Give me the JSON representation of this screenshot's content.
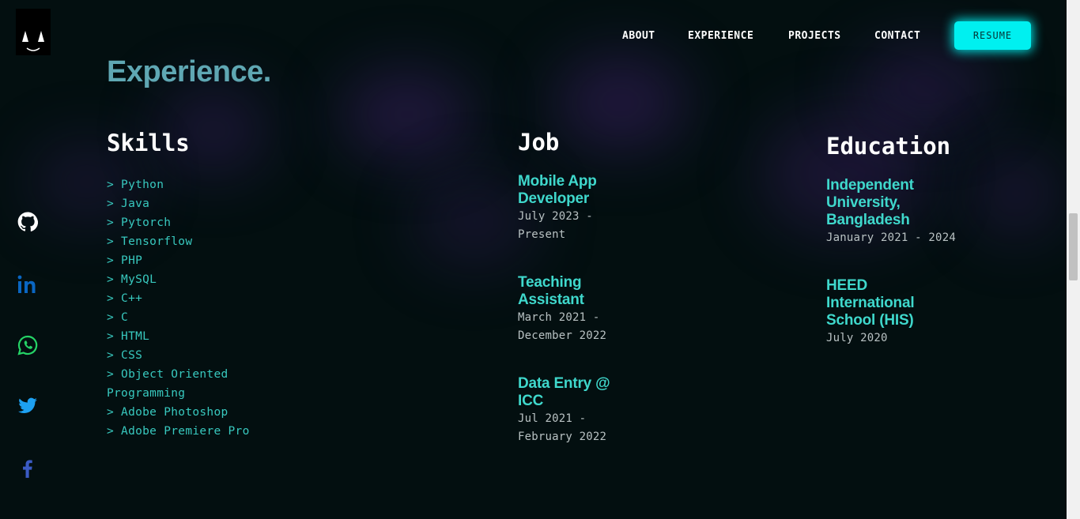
{
  "nav": {
    "items": [
      "ABOUT",
      "EXPERIENCE",
      "PROJECTS",
      "CONTACT"
    ],
    "resume_label": "RESUME"
  },
  "social": [
    "github-icon",
    "linkedin-icon",
    "whatsapp-icon",
    "twitter-icon",
    "facebook-icon"
  ],
  "section_title": "Experience.",
  "skills": {
    "title": "Skills",
    "items": [
      "> Python",
      "> Java",
      "> Pytorch",
      "> Tensorflow",
      "> PHP",
      "> MySQL",
      "> C++",
      "> C",
      "> HTML",
      "> CSS",
      "> Object Oriented Programming",
      "> Adobe Photoshop",
      "> Adobe Premiere Pro"
    ]
  },
  "job": {
    "title": "Job",
    "entries": [
      {
        "role": "Mobile App Developer",
        "date": "July 2023 - Present"
      },
      {
        "role": "Teaching Assistant",
        "date": "March 2021 - December 2022"
      },
      {
        "role": "Data Entry @ ICC",
        "date": "Jul 2021 - February 2022"
      }
    ]
  },
  "education": {
    "title": "Education",
    "entries": [
      {
        "school": "Independent University, Bangladesh",
        "date": "January 2021 - 2024"
      },
      {
        "school": "HEED International School (HIS)",
        "date": "July 2020"
      }
    ]
  },
  "colors": {
    "background": "#030f10",
    "accent": "#00f0f0",
    "entry_title": "#3fd8cc",
    "skill_text": "#38c9bf"
  }
}
